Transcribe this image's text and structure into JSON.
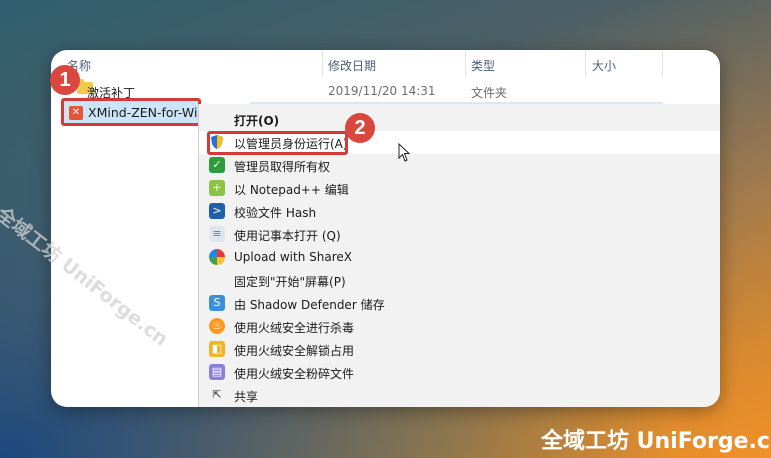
{
  "explorer": {
    "columns": [
      "名称",
      "修改日期",
      "类型",
      "大小"
    ],
    "rows": [
      {
        "name": "激活补丁",
        "date": "2019/11/20 14:31",
        "type": "文件夹"
      }
    ],
    "selected_item": "XMind-ZEN-for-Wi"
  },
  "context_menu": {
    "items": [
      {
        "label": "打开(O)",
        "icon": "none"
      },
      {
        "label": "以管理员身份运行(A)",
        "icon": "shield-icon"
      },
      {
        "label": "管理员取得所有权",
        "icon": "green-shield-icon"
      },
      {
        "label": "以 Notepad++ 编辑",
        "icon": "notepad-plus-icon"
      },
      {
        "label": "校验文件 Hash",
        "icon": "powershell-icon"
      },
      {
        "label": "使用记事本打开 (Q)",
        "icon": "notepad-icon"
      },
      {
        "label": "Upload with ShareX",
        "icon": "sharex-icon"
      },
      {
        "label": "固定到\"开始\"屏幕(P)",
        "icon": "none"
      },
      {
        "label": "由 Shadow Defender 储存",
        "icon": "shadow-defender-icon"
      },
      {
        "label": "使用火绒安全进行杀毒",
        "icon": "huorong-icon"
      },
      {
        "label": "使用火绒安全解锁占用",
        "icon": "unlock-folder-icon"
      },
      {
        "label": "使用火绒安全粉碎文件",
        "icon": "shredder-icon"
      },
      {
        "label": "共享",
        "icon": "share-icon"
      }
    ]
  },
  "badges": {
    "first": "1",
    "second": "2"
  },
  "watermark": {
    "diagonal": "全域工坊 UniForge.cn",
    "corner": "全域工坊 UniForge.cn"
  },
  "colors": {
    "highlight": "#d33a3a",
    "selection": "#cce4f7",
    "menu_bg": "#f2f2f2"
  }
}
